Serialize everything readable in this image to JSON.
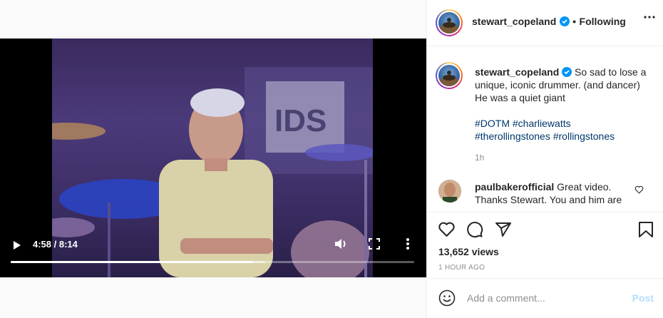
{
  "video": {
    "time_display": "4:58 / 8:14",
    "progress_played": 0.6,
    "progress_buffered": 0.63,
    "icons": [
      "play-icon",
      "volume-icon",
      "fullscreen-icon",
      "more-vertical-icon"
    ]
  },
  "header": {
    "username": "stewart_copeland",
    "separator": "•",
    "follow_status": "Following",
    "more_label": "•••"
  },
  "caption": {
    "username": "stewart_copeland",
    "text": "So sad to lose a unique, iconic drummer. (and dancer) He was a quiet giant",
    "hashtags_line1": "#DOTM #charliewatts",
    "hashtags_line2": "#therollingstones #rollingstones",
    "time_ago": "1h"
  },
  "comment": {
    "username": "paulbakerofficial",
    "text": "Great video. Thanks Stewart. You and him are"
  },
  "stats": {
    "views": "13,652 views",
    "posted": "1 HOUR AGO"
  },
  "composer": {
    "placeholder": "Add a comment...",
    "post_label": "Post"
  },
  "colors": {
    "link": "#00376b",
    "verified": "#0095f6",
    "post_disabled": "#b2dffc"
  }
}
